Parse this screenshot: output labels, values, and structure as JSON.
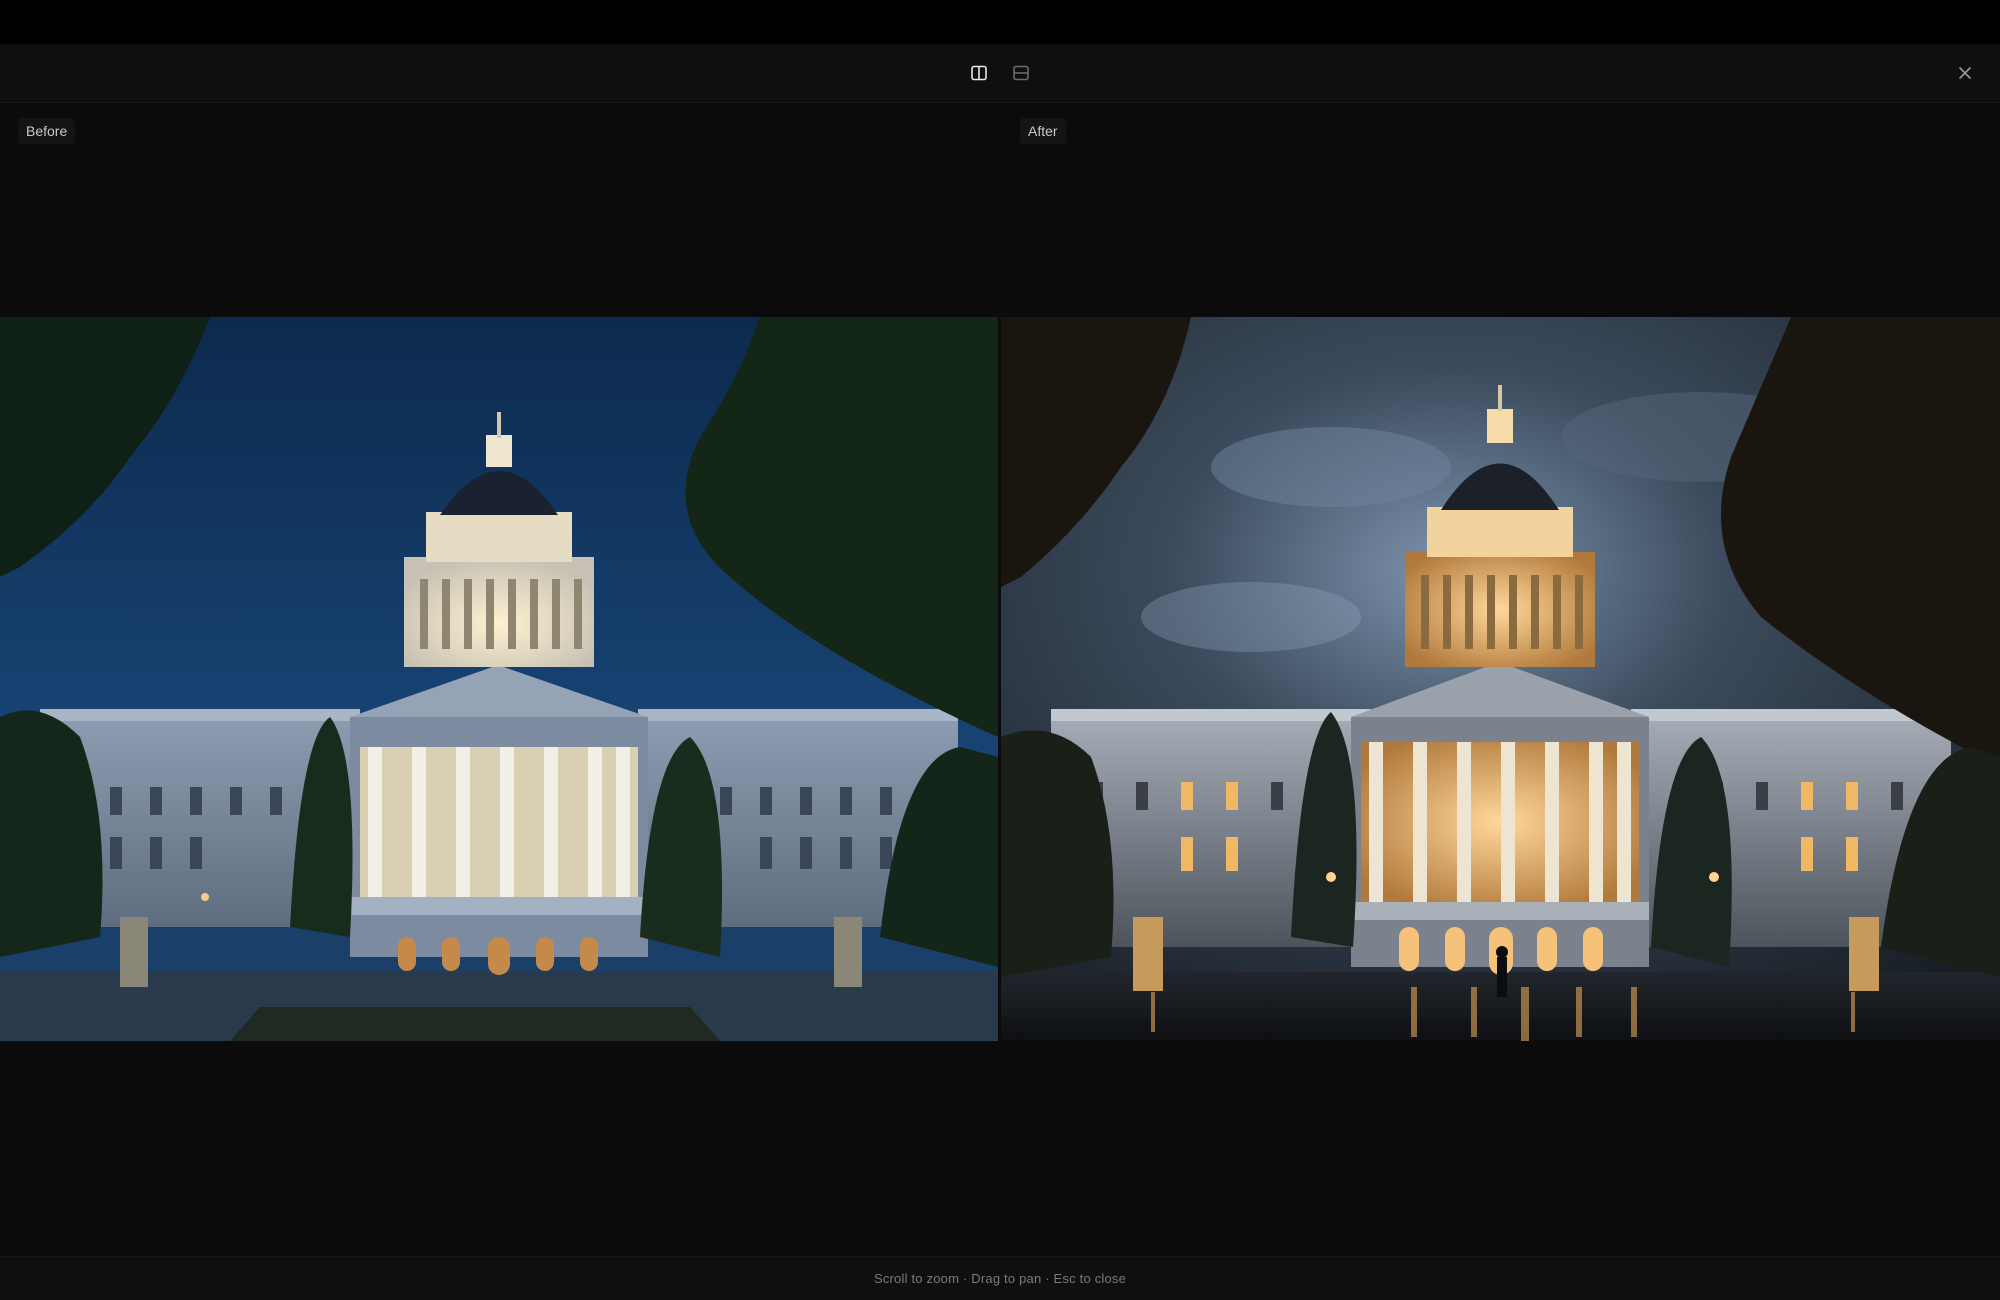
{
  "toolbar": {
    "side_by_side_icon": "columns-icon",
    "stacked_icon": "rows-icon",
    "close_icon": "close-icon"
  },
  "panes": {
    "before": {
      "label": "Before",
      "image_alt": "Capitol building at dusk under a deep blue sky, framed by trees"
    },
    "after": {
      "label": "After",
      "image_alt": "Capitol building at night under dramatic storm clouds with warm glowing lights and wet reflective plaza"
    }
  },
  "footer": {
    "hint": "Scroll to zoom · Drag to pan · Esc to close"
  },
  "colors": {
    "background": "#0b0b0c",
    "toolbar": "#0f0f10",
    "label_text": "#c9c9cb",
    "hint_text": "#7a7a7e",
    "active_icon": "#e6e6e8",
    "inactive_icon": "#6b6b70"
  },
  "view_mode": "side-by-side"
}
